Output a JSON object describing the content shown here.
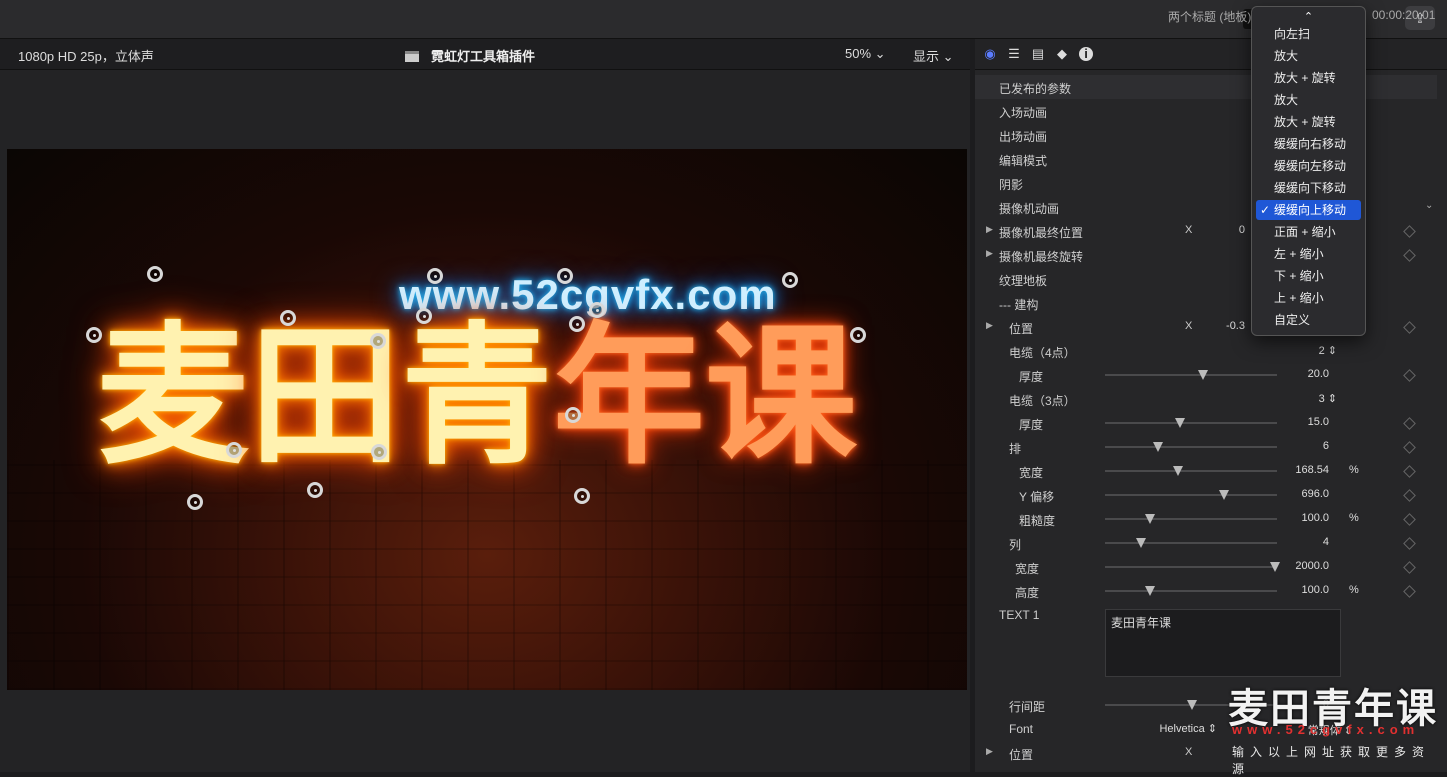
{
  "viewer": {
    "format": "1080p HD 25p，立体声",
    "project_title": "霓虹灯工具箱插件",
    "zoom": "50%",
    "display_label": "显示",
    "url_overlay": "www.52cgvfx.com",
    "title_chars": [
      "麦",
      "田",
      "青",
      "年",
      "课"
    ]
  },
  "inspector": {
    "title": "两个标题 (地板)",
    "timecode": "00:00:20:01",
    "rows": {
      "published_params": "已发布的参数",
      "intro_anim": "入场动画",
      "outro_anim": "出场动画",
      "edit_mode": "编辑模式",
      "shadow": "阴影",
      "camera_anim": "摄像机动画",
      "camera_final_pos": "摄像机最终位置",
      "camera_final_pos_x": "0",
      "camera_final_rot": "摄像机最终旋转",
      "texture_floor": "纹理地板",
      "build": "--- 建构",
      "position": "位置",
      "position_x": "-0.3",
      "cable4": "电缆（4点）",
      "cable4_val": "2",
      "thickness": "厚度",
      "thickness1_val": "20.0",
      "cable3": "电缆（3点）",
      "cable3_val": "3",
      "thickness2_val": "15.0",
      "rows_label": "排",
      "rows_val": "6",
      "width": "宽度",
      "width1_val": "168.54",
      "percent": "%",
      "y_offset": "Y 偏移",
      "y_offset_val": "696.0",
      "roughness": "粗糙度",
      "roughness_val": "100.0",
      "columns": "列",
      "columns_val": "4",
      "width2_val": "2000.0",
      "height": "高度",
      "height_val": "100.0",
      "text1": "TEXT 1",
      "text1_val": "麦田青年课",
      "line_spacing": "行间距",
      "line_spacing_val": "0",
      "font": "Font",
      "font_val": "Helvetica",
      "font_style": "常规体",
      "position2": "位置",
      "x_label": "X"
    }
  },
  "menu": {
    "items": [
      "向左扫",
      "放大",
      "放大 + 旋转",
      "放大",
      "放大 + 旋转",
      "缓缓向右移动",
      "缓缓向左移动",
      "缓缓向下移动",
      "缓缓向上移动",
      "正面 + 缩小",
      "左 + 缩小",
      "下 + 缩小",
      "上 + 缩小",
      "自定义"
    ],
    "selected_index": 8
  },
  "watermark": {
    "title": "麦田青年课",
    "url": "www.52cgvfx.com",
    "sub": "输入以上网址获取更多资源"
  },
  "colors": {
    "accent": "#1f57d6",
    "neon_yellow": "#ffb300",
    "neon_blue": "#26c4ff"
  }
}
